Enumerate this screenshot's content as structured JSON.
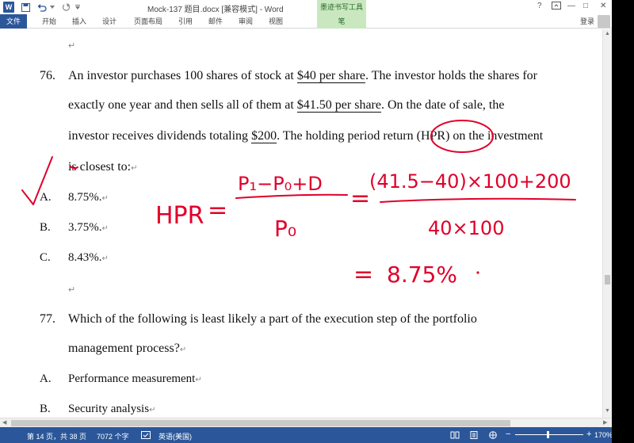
{
  "titlebar": {
    "word_logo": "W",
    "save_icon": "save-icon",
    "undo_icon": "undo-icon",
    "redo_icon": "redo-icon",
    "doc_title": "Mock-137 题目.docx [兼容模式] - Word",
    "tool_title": "墨迹书写工具",
    "help": "?",
    "min": "—",
    "max": "□",
    "close": "✕"
  },
  "ribbon": {
    "tabs": [
      "文件",
      "开始",
      "插入",
      "设计",
      "页面布局",
      "引用",
      "邮件",
      "审阅",
      "视图",
      "笔"
    ],
    "login": "登录"
  },
  "document": {
    "para_mark": "↵",
    "q76": {
      "number": "76.",
      "line1": [
        "An investor purchases 100 shares of stock at ",
        "$40 per share",
        ". The investor holds the shares for"
      ],
      "line2": [
        "exactly one year and then sells all of them at ",
        "$41.50 per share",
        ". On the date of sale, the"
      ],
      "line3": [
        "investor receives dividends totaling ",
        "$200",
        ". The holding period return (HPR) on the investment"
      ],
      "line4": "is closest to:",
      "options": [
        {
          "letter": "A.",
          "text": "8.75%."
        },
        {
          "letter": "B.",
          "text": "3.75%."
        },
        {
          "letter": "C.",
          "text": "8.43%."
        }
      ]
    },
    "q77": {
      "number": "77.",
      "line1": "Which of the following is least likely a part of the execution step of the portfolio",
      "line2": "management process?",
      "options": [
        {
          "letter": "A.",
          "text": "Performance measurement"
        },
        {
          "letter": "B.",
          "text": "Security analysis"
        }
      ]
    }
  },
  "ink": {
    "color": "#e0002a",
    "hpr": "HPR",
    "eq": "=",
    "numerator": "P₁−P₀+D",
    "denominator": "P₀",
    "eq2": "=",
    "calc_num": "(41.5−40)×100+200",
    "calc_den": "40×100",
    "eq3": "=",
    "result": "8.75%"
  },
  "status": {
    "page": "第 14 页，共 38 页",
    "words": "7072 个字",
    "lang": "英语(美国)",
    "zoom": "170%",
    "zoom_minus": "−",
    "zoom_plus": "+"
  },
  "colors": {
    "accent": "#2b579a",
    "pen_tab": "#c9e8c0",
    "ink": "#e0002a"
  }
}
